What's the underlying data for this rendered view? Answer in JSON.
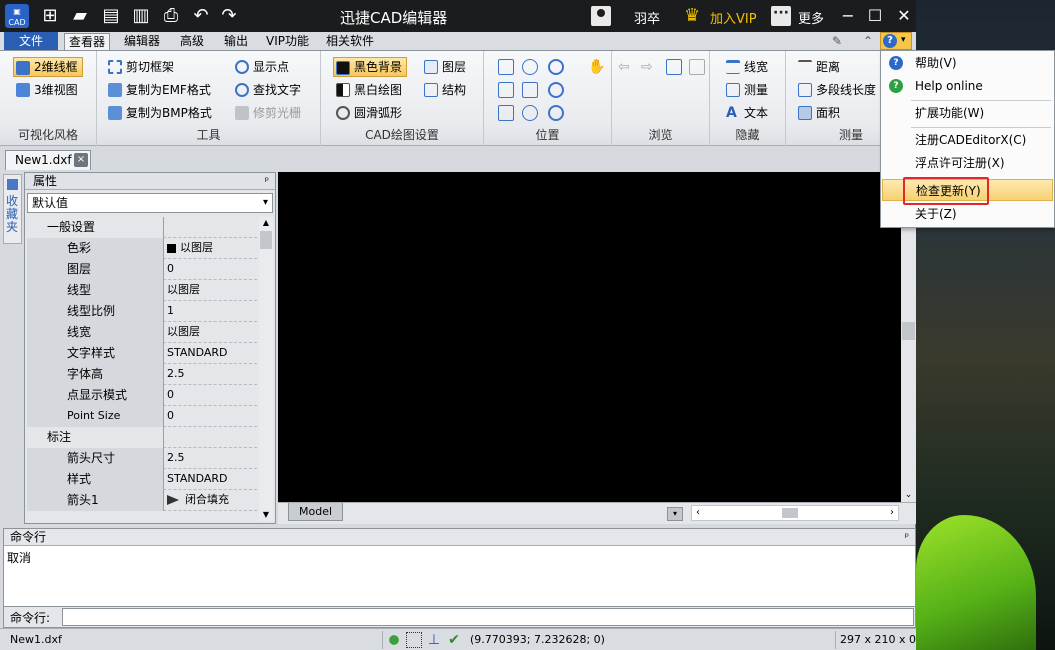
{
  "titlebar": {
    "logo_text": "CAD",
    "title": "迅捷CAD编辑器",
    "user_name": "羽卒",
    "vip_label": "加入VIP",
    "more_label": "更多"
  },
  "menubar": {
    "file_tab": "文件",
    "tabs": [
      "查看器",
      "编辑器",
      "高级",
      "输出",
      "VIP功能",
      "相关软件"
    ],
    "active_tab": "查看器"
  },
  "ribbon": {
    "groups": [
      {
        "label": "可视化风格",
        "buttons": [
          "2维线框",
          "3维视图"
        ]
      },
      {
        "label": "工具",
        "buttons": [
          "剪切框架",
          "复制为EMF格式",
          "复制为BMP格式",
          "显示点",
          "查找文字",
          "修剪光栅"
        ]
      },
      {
        "label": "CAD绘图设置",
        "buttons": [
          "黑色背景",
          "黑白绘图",
          "圆滑弧形",
          "图层",
          "结构"
        ]
      },
      {
        "label": "位置",
        "buttons": []
      },
      {
        "label": "浏览",
        "buttons": []
      },
      {
        "label": "隐藏",
        "buttons": [
          "线宽",
          "测量",
          "文本"
        ]
      },
      {
        "label": "测量",
        "buttons": [
          "距离",
          "多段线长度",
          "面积"
        ]
      }
    ]
  },
  "doc_tab": {
    "name": "New1.dxf",
    "close": "×"
  },
  "side_strip": {
    "label": "收藏夹"
  },
  "properties": {
    "title": "属性",
    "pin": "ᵖ",
    "select_value": "默认值",
    "sections": [
      {
        "title": "一般设置",
        "expander": "−",
        "rows": [
          {
            "name": "色彩",
            "value": "以图层"
          },
          {
            "name": "图层",
            "value": "0"
          },
          {
            "name": "线型",
            "value": "以图层"
          },
          {
            "name": "线型比例",
            "value": "1"
          },
          {
            "name": "线宽",
            "value": "以图层"
          },
          {
            "name": "文字样式",
            "value": "STANDARD"
          },
          {
            "name": "字体高",
            "value": "2.5"
          },
          {
            "name": "点显示模式",
            "value": "0"
          },
          {
            "name": "Point Size",
            "value": "0"
          }
        ]
      },
      {
        "title": "标注",
        "expander": "−",
        "rows": [
          {
            "name": "箭头尺寸",
            "value": "2.5"
          },
          {
            "name": "样式",
            "value": "STANDARD"
          },
          {
            "name": "箭头1",
            "value": "闭合填充"
          }
        ]
      }
    ]
  },
  "canvas": {
    "model_tab": "Model"
  },
  "command": {
    "title": "命令行",
    "output": "取消",
    "prompt": "命令行:"
  },
  "status": {
    "file": "New1.dxf",
    "coords": "(9.770393; 7.232628; 0)",
    "size": "297 x 210 x 0"
  },
  "help_menu": {
    "items": [
      {
        "label": "帮助(V)",
        "icon": "help-icon"
      },
      {
        "label": "Help online",
        "icon": "help-online-icon"
      },
      {
        "label": "扩展功能(W)"
      },
      {
        "label": "注册CADEditorX(C)"
      },
      {
        "label": "浮点许可注册(X)"
      },
      {
        "label": "检查更新(Y)",
        "highlighted": true
      },
      {
        "label": "关于(Z)"
      }
    ]
  },
  "colors": {
    "accent": "#2b5fb4",
    "highlight": "#e5262a",
    "vip": "#f2c200"
  }
}
